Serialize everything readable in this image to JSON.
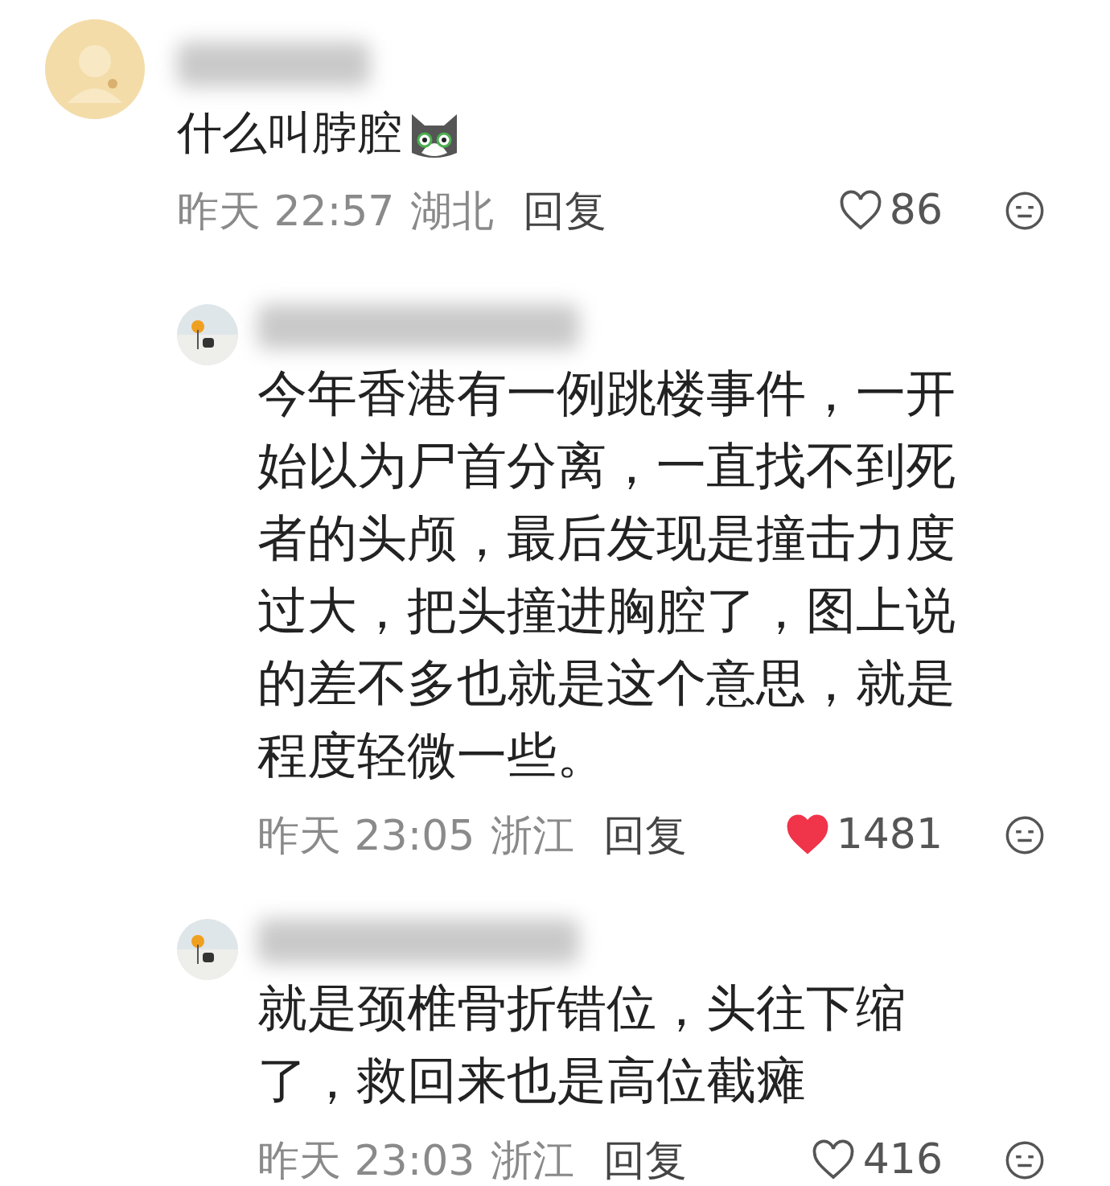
{
  "comments": [
    {
      "kind": "top",
      "text": "什么叫脖腔",
      "emoji": true,
      "time": "昨天 22:57",
      "location": "湖北",
      "reply": "回复",
      "liked": false,
      "likes": "86"
    },
    {
      "kind": "reply",
      "text": "今年香港有一例跳楼事件，一开始以为尸首分离，一直找不到死者的头颅，最后发现是撞击力度过大，把头撞进胸腔了，图上说的差不多也就是这个意思，就是程度轻微一些。",
      "emoji": false,
      "time": "昨天 23:05",
      "location": "浙江",
      "reply": "回复",
      "liked": true,
      "likes": "1481"
    },
    {
      "kind": "reply",
      "text": "就是颈椎骨折错位，头往下缩了，救回来也是高位截瘫",
      "emoji": false,
      "time": "昨天 23:03",
      "location": "浙江",
      "reply": "回复",
      "liked": false,
      "likes": "416"
    }
  ]
}
